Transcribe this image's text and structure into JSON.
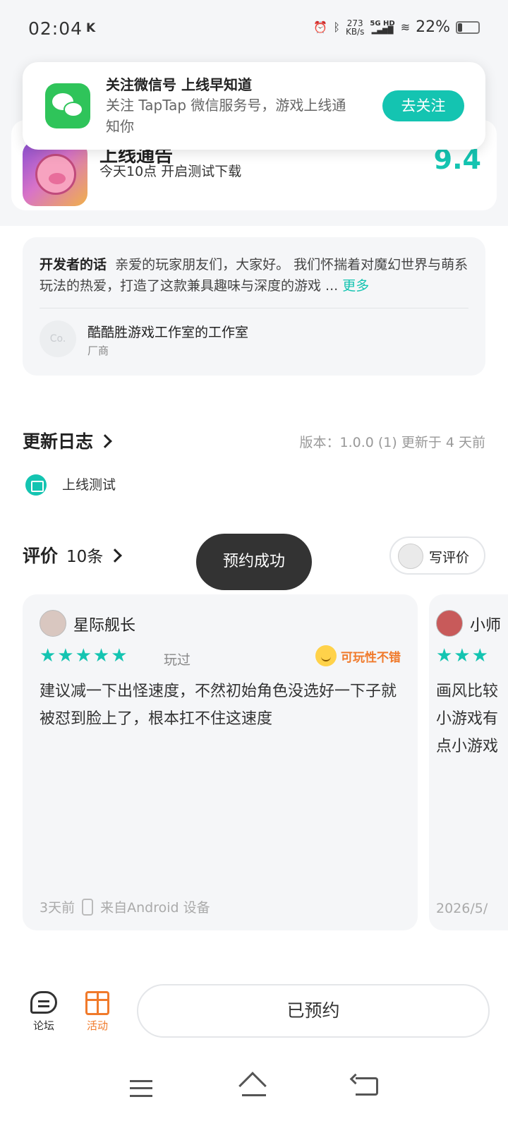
{
  "status_bar": {
    "time": "02:04",
    "k_label": "K",
    "speed_value": "273",
    "speed_unit": "KB/s",
    "network": "5G HD",
    "battery": "22%"
  },
  "wechat_popup": {
    "title": "关注微信号 上线早知道",
    "desc": "关注 TapTap 微信服务号，游戏上线通知你",
    "button": "去关注"
  },
  "app": {
    "name": "上线通告",
    "subtitle": "今天10点 开启测试下载",
    "score": "9.4"
  },
  "developer": {
    "label": "开发者的话",
    "text": "亲爱的玩家朋友们，大家好。 我们怀揣着对魔幻世界与萌系玩法的热爱，打造了这款兼具趣味与深度的游戏 ...",
    "more": "更多",
    "avatar_text": "Co.",
    "studio": "酷酷胜游戏工作室的工作室",
    "role": "厂商"
  },
  "update_log": {
    "title": "更新日志",
    "version_info": "版本：1.0.0 (1)   更新于 4 天前",
    "item": "上线测试"
  },
  "reviews": {
    "title": "评价",
    "count": "10条",
    "write_button": "写评价",
    "toast": "预约成功",
    "items": [
      {
        "user": "星际舰长",
        "stars": "★★★★★",
        "played": "玩过",
        "tag": "可玩性不错",
        "text": "建议减一下出怪速度，不然初始角色没选好一下子就被怼到脸上了，根本扛不住这速度",
        "time": "3天前",
        "device": "来自Android 设备"
      },
      {
        "user": "小师",
        "stars": "★★★",
        "text": "画风比较小游戏有点小游戏",
        "time": "2026/5/"
      }
    ]
  },
  "bottom_bar": {
    "forum": "论坛",
    "activity": "活动",
    "reserve_button": "已预约"
  },
  "colors": {
    "accent": "#14c4b1",
    "orange": "#f07a2b",
    "wechat": "#2fc45a"
  }
}
